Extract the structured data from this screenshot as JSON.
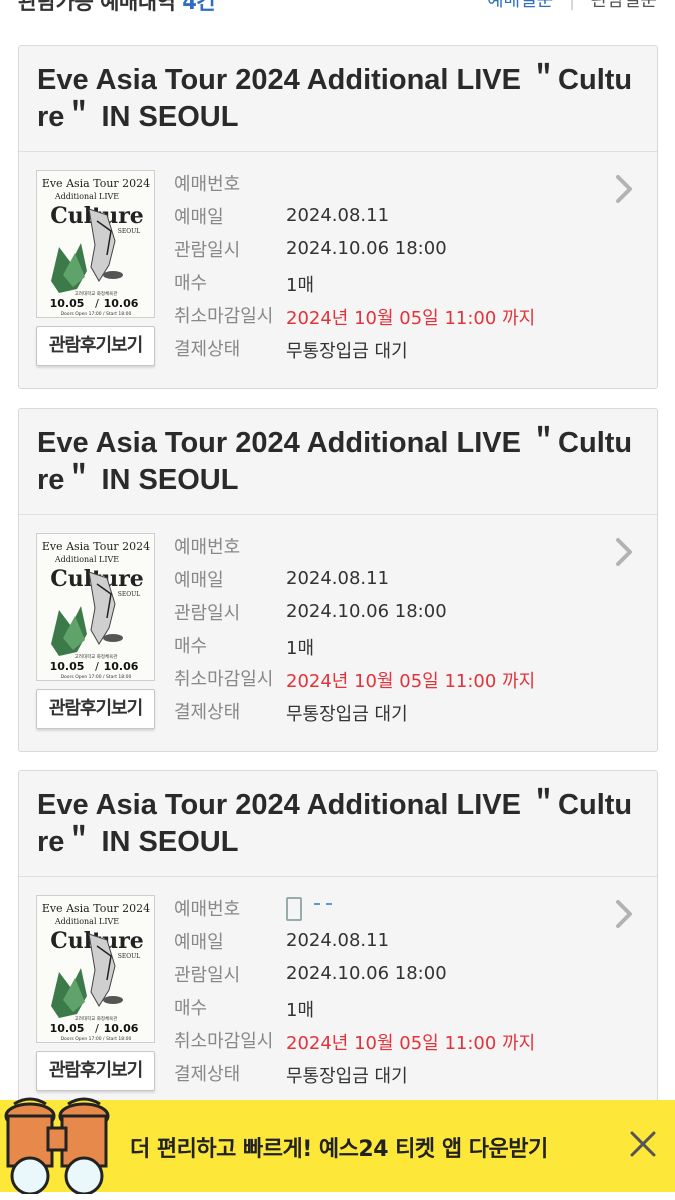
{
  "header": {
    "title_prefix": "관람가능 예매내역",
    "count": "4건",
    "link_reservation": "예매일순",
    "link_viewing": "관람일순"
  },
  "labels": {
    "booking_no": "예매번호",
    "booking_date": "예매일",
    "view_datetime": "관람일시",
    "quantity": "매수",
    "cancel_deadline": "취소마감일시",
    "payment_status": "결제상태",
    "review_button": "관람후기보기"
  },
  "poster": {
    "line1": "Eve Asia Tour 2024",
    "line2": "Additional LIVE",
    "line3": "Culture",
    "line4": "SEOUL",
    "venue": "고려대학교 화정체육관",
    "dates": "10.05",
    "dates2": "10.06",
    "doors": "Doors Open 17:00 / Start 18:00"
  },
  "tickets": [
    {
      "title": "Eve Asia Tour 2024 Additional LIVE ＂Culture＂ IN SEOUL",
      "booking_no": "",
      "booking_date": "2024.08.11",
      "view_datetime": "2024.10.06 18:00",
      "quantity": "1매",
      "cancel_deadline": "2024년 10월 05일 11:00 까지",
      "payment_status": "무통장입금 대기"
    },
    {
      "title": "Eve Asia Tour 2024 Additional LIVE ＂Culture＂ IN SEOUL",
      "booking_no": "",
      "booking_date": "2024.08.11",
      "view_datetime": "2024.10.06 18:00",
      "quantity": "1매",
      "cancel_deadline": "2024년 10월 05일 11:00 까지",
      "payment_status": "무통장입금 대기"
    },
    {
      "title": "Eve Asia Tour 2024 Additional LIVE ＂Culture＂ IN SEOUL",
      "booking_no": "",
      "booking_date": "2024.08.11",
      "view_datetime": "2024.10.06 18:00",
      "quantity": "1매",
      "cancel_deadline": "2024년 10월 05일 11:00 까지",
      "payment_status": "무통장입금 대기"
    }
  ],
  "banner": {
    "text": "더 편리하고 빠르게! 예스24 티켓 앱 다운받기"
  },
  "colors": {
    "accent_blue": "#2d6fc4",
    "deadline_red": "#e2333b",
    "banner_yellow": "#fde83a"
  }
}
